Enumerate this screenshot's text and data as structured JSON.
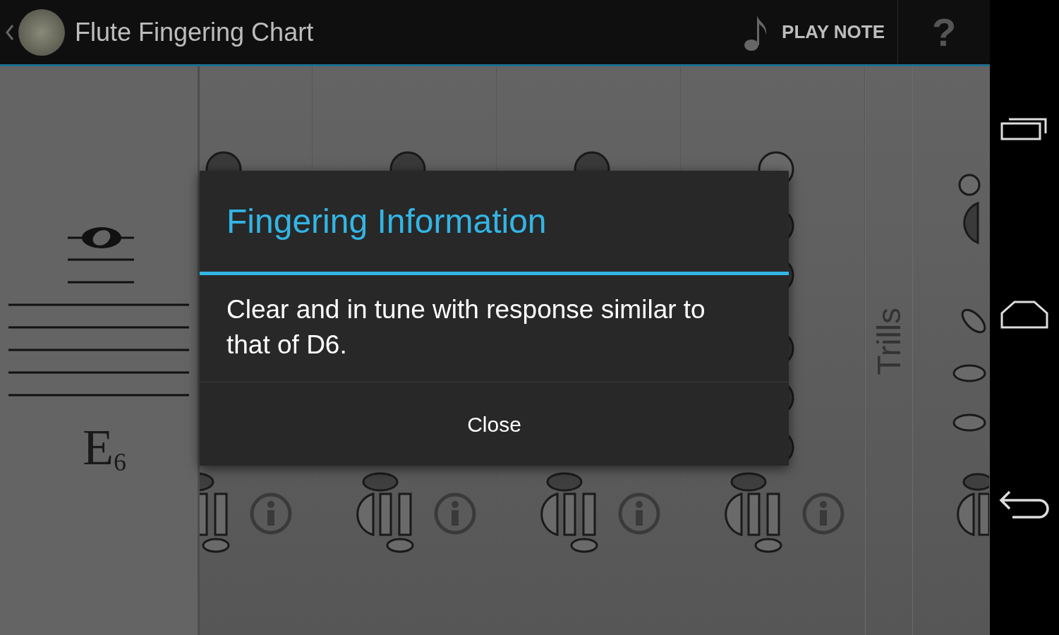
{
  "action_bar": {
    "title": "Flute Fingering Chart",
    "play_note": "PLAY NOTE",
    "help": "?"
  },
  "note": {
    "name": "E$_{6}$"
  },
  "trills": {
    "label": "Trills"
  },
  "dialog": {
    "title": "Fingering Information",
    "message": "Clear and in tune with response similar to that of D6.",
    "button": "Close"
  }
}
